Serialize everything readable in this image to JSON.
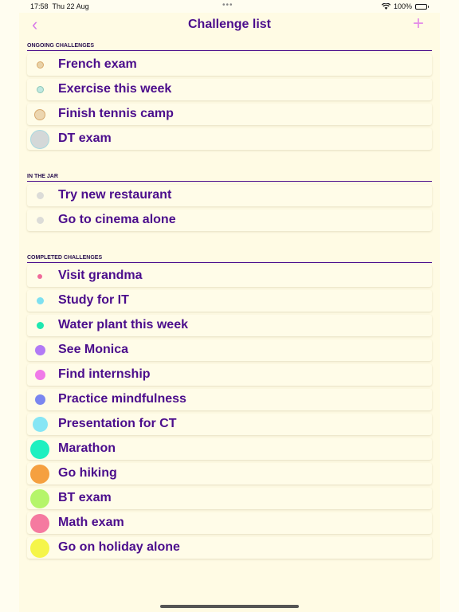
{
  "status": {
    "time": "17:58",
    "date": "Thu 22 Aug",
    "battery": "100%"
  },
  "nav": {
    "back": "‹",
    "title": "Challenge list",
    "add": "+"
  },
  "sections": {
    "ongoing": {
      "title": "ONGOING CHALLENGES",
      "items": [
        {
          "label": "French exam",
          "color": "#e8d2a8",
          "border": "#d9a96a"
        },
        {
          "label": "Exercise this week",
          "color": "#bfe8e0",
          "border": "#8cc7b8"
        },
        {
          "label": "Finish tennis camp",
          "color": "#ecd6b0",
          "border": "#d7a96e"
        },
        {
          "label": "DT exam",
          "color": "#d4d8d8",
          "border": "#a8d9e0"
        }
      ]
    },
    "jar": {
      "title": "IN THE JAR",
      "items": [
        {
          "label": "Try new restaurant",
          "color": "#dcdcd8",
          "border": "#dcdcd8"
        },
        {
          "label": "Go to cinema alone",
          "color": "#dcdcd8",
          "border": "#dcdcd8"
        }
      ]
    },
    "completed": {
      "title": "COMPLETED CHALLENGES",
      "items": [
        {
          "label": "Visit grandma",
          "color": "#f06a9a"
        },
        {
          "label": "Study for IT",
          "color": "#7ee0f0"
        },
        {
          "label": "Water plant this week",
          "color": "#1ee8b0"
        },
        {
          "label": "See Monica",
          "color": "#b27af5"
        },
        {
          "label": "Find internship",
          "color": "#f07ae8"
        },
        {
          "label": "Practice mindfulness",
          "color": "#7a86f0"
        },
        {
          "label": "Presentation for CT",
          "color": "#86e6f5"
        },
        {
          "label": "Marathon",
          "color": "#1ef0c0"
        },
        {
          "label": "Go hiking",
          "color": "#f5a040"
        },
        {
          "label": "BT exam",
          "color": "#b5f56a"
        },
        {
          "label": "Math exam",
          "color": "#f57aa0"
        },
        {
          "label": "Go on holiday alone",
          "color": "#f5f54a"
        }
      ]
    }
  }
}
